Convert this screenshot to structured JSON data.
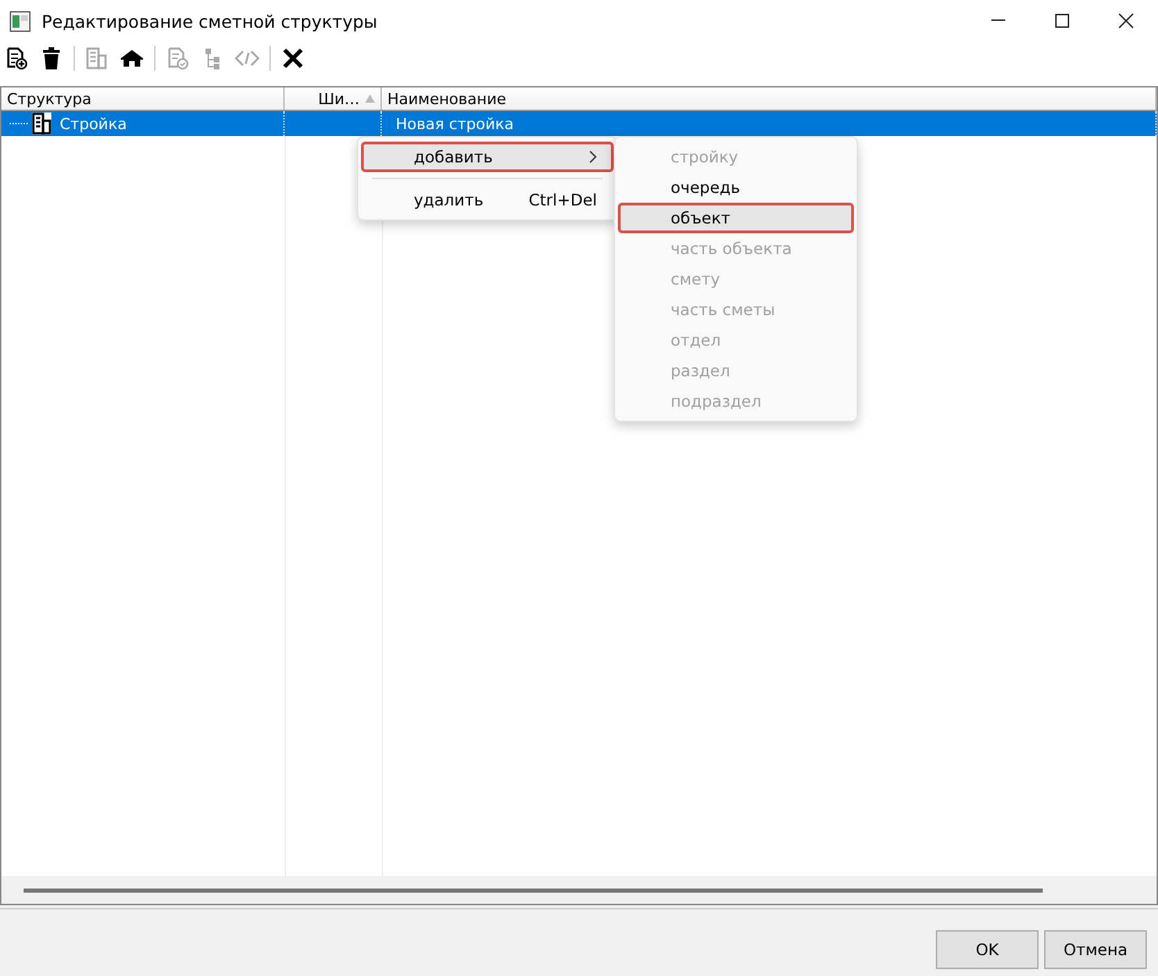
{
  "window": {
    "title": "Редактирование сметной структуры"
  },
  "toolbar": [
    {
      "kind": "add-doc",
      "disabled": false
    },
    {
      "kind": "trash",
      "disabled": false
    },
    {
      "kind": "sep"
    },
    {
      "kind": "building",
      "disabled": true
    },
    {
      "kind": "house",
      "disabled": false
    },
    {
      "kind": "sep"
    },
    {
      "kind": "doc-check",
      "disabled": true
    },
    {
      "kind": "tree",
      "disabled": true
    },
    {
      "kind": "code",
      "disabled": true
    },
    {
      "kind": "sep"
    },
    {
      "kind": "close",
      "disabled": false
    }
  ],
  "table": {
    "columns": [
      {
        "label": "Структура"
      },
      {
        "label": "Ши…",
        "sorted": true
      },
      {
        "label": "Наименование"
      }
    ],
    "rows": [
      {
        "structure": "Стройка",
        "column_2": "",
        "name": "Новая стройка",
        "selected": true
      }
    ]
  },
  "context_menu": {
    "items": [
      {
        "kind": "submenu",
        "label": "добавить",
        "selected": true,
        "highlighted": true
      },
      {
        "kind": "sep"
      },
      {
        "kind": "item",
        "label": "удалить",
        "shortcut": "Ctrl+Del",
        "selected": false,
        "highlighted": false
      }
    ]
  },
  "submenu": {
    "items": [
      {
        "label": "стройку",
        "disabled": true,
        "selected": false,
        "highlighted": false
      },
      {
        "label": "очередь",
        "disabled": false,
        "selected": false,
        "highlighted": false
      },
      {
        "label": "объект",
        "disabled": false,
        "selected": true,
        "highlighted": true
      },
      {
        "label": "часть объекта",
        "disabled": true,
        "selected": false,
        "highlighted": false
      },
      {
        "label": "смету",
        "disabled": true,
        "selected": false,
        "highlighted": false
      },
      {
        "label": "часть сметы",
        "disabled": true,
        "selected": false,
        "highlighted": false
      },
      {
        "label": "отдел",
        "disabled": true,
        "selected": false,
        "highlighted": false
      },
      {
        "label": "раздел",
        "disabled": true,
        "selected": false,
        "highlighted": false
      },
      {
        "label": "подраздел",
        "disabled": true,
        "selected": false,
        "highlighted": false
      }
    ]
  },
  "buttons": [
    {
      "label": "OK"
    },
    {
      "label": "Отмена"
    }
  ]
}
